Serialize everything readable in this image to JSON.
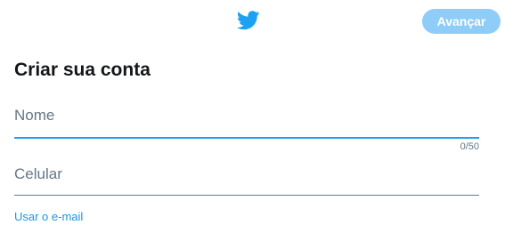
{
  "header": {
    "logo_icon": "twitter-bird-icon",
    "next_label": "Avançar"
  },
  "form": {
    "title": "Criar sua conta",
    "name_placeholder": "Nome",
    "name_value": "",
    "name_counter": "0/50",
    "phone_placeholder": "Celular",
    "phone_value": "",
    "use_email_label": "Usar o e-mail"
  },
  "colors": {
    "brand": "#1da1f2",
    "button_disabled": "#8ecdf8",
    "link": "#1b95e0",
    "muted_text": "#657786",
    "title_text": "#14171a"
  }
}
